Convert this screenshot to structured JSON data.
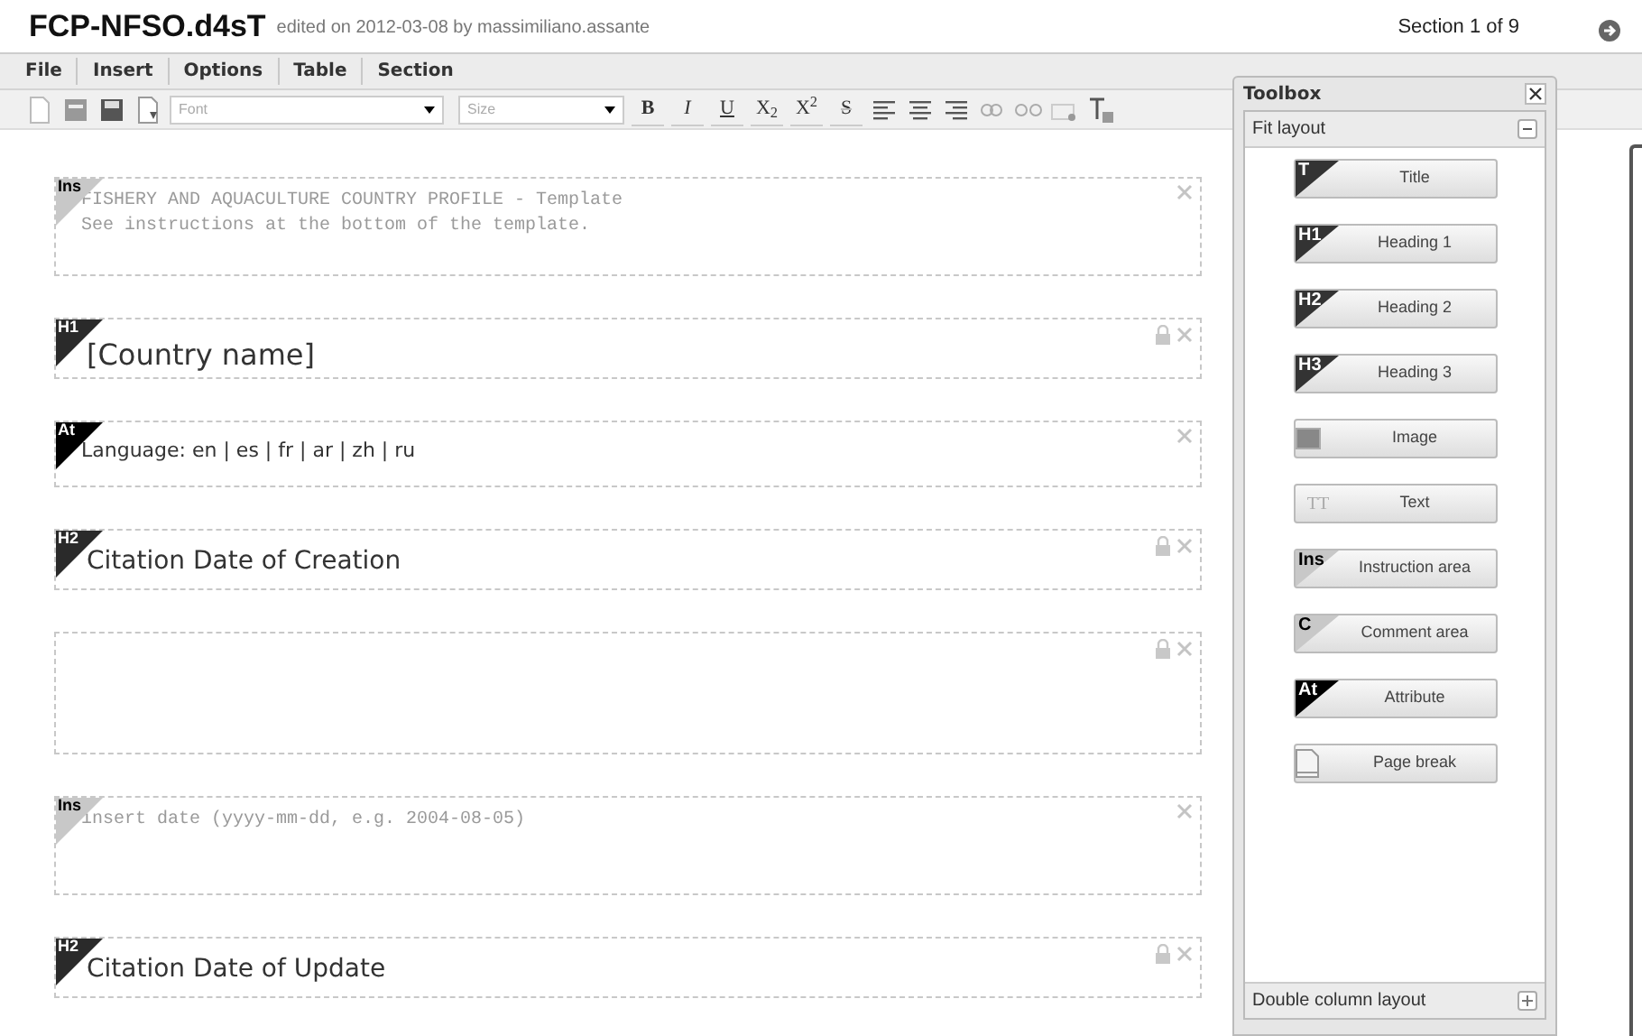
{
  "header": {
    "title": "FCP-NFSO.d4sT",
    "edited": "edited on 2012-03-08  by massimiliano.assante",
    "section": "Section 1 of 9"
  },
  "menu": [
    "File",
    "Insert",
    "Options",
    "Table",
    "Section"
  ],
  "toolbar": {
    "font_placeholder": "Font",
    "size_placeholder": "Size",
    "format_buttons": [
      {
        "label": "B",
        "kind": "bold"
      },
      {
        "label": "I",
        "kind": "italic"
      },
      {
        "label": "U",
        "kind": "underline"
      },
      {
        "label": "X$_{2}$",
        "kind": "plain"
      },
      {
        "label": "X$^{2}$",
        "kind": "plain"
      },
      {
        "label": "S",
        "kind": "strike"
      }
    ]
  },
  "blocks": [
    {
      "kind": "instruction",
      "tag": "Ins",
      "lines": [
        "FISHERY AND AQUACULTURE COUNTRY PROFILE - Template",
        "See instructions at the bottom of the template."
      ],
      "locked": false
    },
    {
      "kind": "heading1",
      "tag": "H1",
      "lines": [
        "[Country name]"
      ],
      "locked": true
    },
    {
      "kind": "attribute",
      "tag": "At",
      "lines": [
        "Language: en | es | fr | ar | zh | ru"
      ],
      "locked": false
    },
    {
      "kind": "heading2",
      "tag": "H2",
      "lines": [
        "Citation Date of Creation"
      ],
      "locked": true
    },
    {
      "kind": "empty",
      "locked": true
    },
    {
      "kind": "instruction",
      "tag": "Ins",
      "lines": [
        "insert date (yyyy-mm-dd, e.g. 2004-08-05)"
      ],
      "locked": false
    },
    {
      "kind": "heading2",
      "tag": "H2",
      "lines": [
        "Citation Date of Update"
      ],
      "locked": true
    }
  ],
  "toolbox": {
    "title": "Toolbox",
    "fit_layout": {
      "label": "Fit layout",
      "expanded": true
    },
    "items": [
      {
        "label": "Title",
        "kind": "dark",
        "tag": "T"
      },
      {
        "label": "Heading 1",
        "kind": "dark",
        "tag": "H1"
      },
      {
        "label": "Heading 2",
        "kind": "dark",
        "tag": "H2"
      },
      {
        "label": "Heading 3",
        "kind": "dark",
        "tag": "H3"
      },
      {
        "label": "Image",
        "kind": "image"
      },
      {
        "label": "Text",
        "kind": "text",
        "tag": "TT"
      },
      {
        "label": "Instruction area",
        "kind": "light",
        "tag": "Ins"
      },
      {
        "label": "Comment area",
        "kind": "light",
        "tag": "C"
      },
      {
        "label": "Attribute",
        "kind": "black",
        "tag": "At"
      },
      {
        "label": "Page break",
        "kind": "page"
      }
    ],
    "double_layout": {
      "label": "Double column layout",
      "expanded": false
    }
  }
}
